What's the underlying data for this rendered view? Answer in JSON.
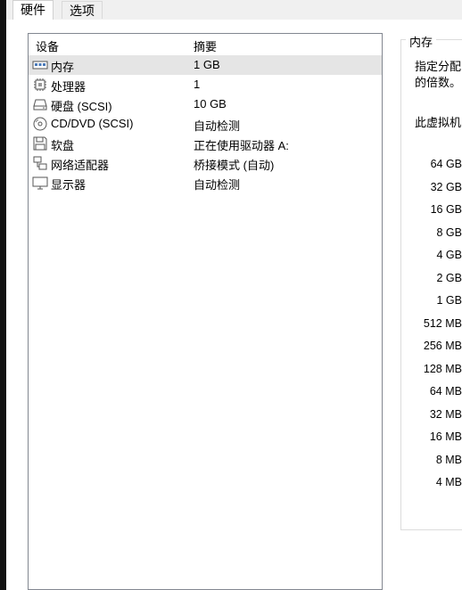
{
  "tabs": [
    {
      "label": "硬件",
      "active": true
    },
    {
      "label": "选项",
      "active": false
    }
  ],
  "device_list": {
    "columns": {
      "device": "设备",
      "summary": "摘要"
    },
    "rows": [
      {
        "icon": "memory-icon",
        "name": "内存",
        "summary": "1 GB",
        "selected": true
      },
      {
        "icon": "processor-icon",
        "name": "处理器",
        "summary": "1"
      },
      {
        "icon": "hard-disk-icon",
        "name": "硬盘 (SCSI)",
        "summary": "10 GB"
      },
      {
        "icon": "cd-dvd-icon",
        "name": "CD/DVD (SCSI)",
        "summary": "自动检测"
      },
      {
        "icon": "floppy-icon",
        "name": "软盘",
        "summary": "正在使用驱动器 A:"
      },
      {
        "icon": "network-adapter-icon",
        "name": "网络适配器",
        "summary": "桥接模式 (自动)"
      },
      {
        "icon": "display-icon",
        "name": "显示器",
        "summary": "自动检测"
      }
    ]
  },
  "memory_panel": {
    "title": "内存",
    "description_line1": "指定分配",
    "description_line2": "的倍数。",
    "description_line3": "此虚拟机",
    "scale_labels": [
      "64 GB",
      "32 GB",
      "16 GB",
      "8 GB",
      "4 GB",
      "2 GB",
      "1 GB",
      "512 MB",
      "256 MB",
      "128 MB",
      "64 MB",
      "32 MB",
      "16 MB",
      "8 MB",
      "4 MB"
    ]
  }
}
